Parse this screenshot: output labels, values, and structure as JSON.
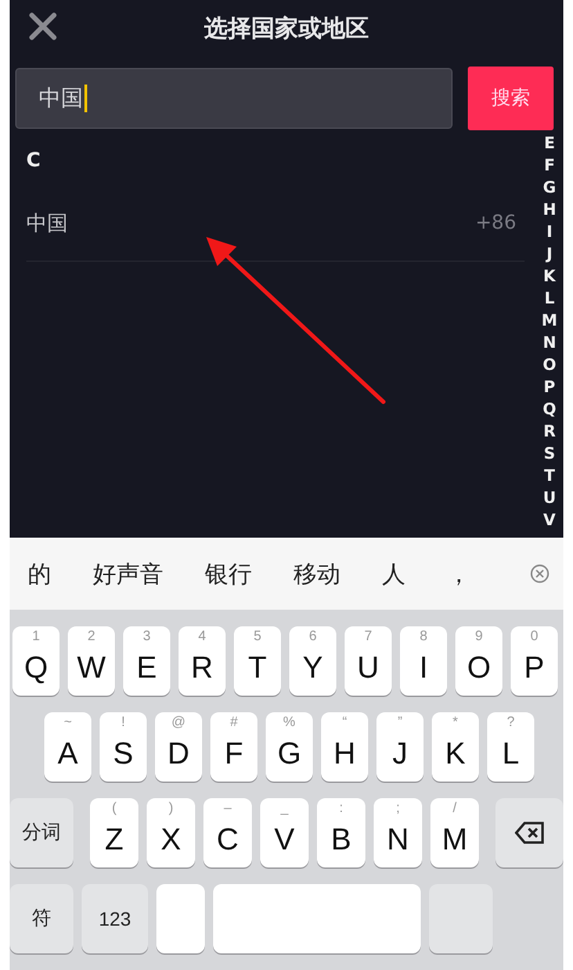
{
  "header": {
    "title": "选择国家或地区"
  },
  "search": {
    "value": "中国",
    "button": "搜索"
  },
  "sections": [
    {
      "letter": "C",
      "countries": [
        {
          "name": "中国",
          "code": "+86"
        }
      ]
    }
  ],
  "index": [
    "E",
    "F",
    "G",
    "H",
    "I",
    "J",
    "K",
    "L",
    "M",
    "N",
    "O",
    "P",
    "Q",
    "R",
    "S",
    "T",
    "U",
    "V"
  ],
  "candidates": [
    "的",
    "好声音",
    "银行",
    "移动",
    "人",
    "，"
  ],
  "keyboard": {
    "rows": [
      [
        {
          "kind": "letter",
          "label": "Q",
          "hint": "1"
        },
        {
          "kind": "letter",
          "label": "W",
          "hint": "2"
        },
        {
          "kind": "letter",
          "label": "E",
          "hint": "3"
        },
        {
          "kind": "letter",
          "label": "R",
          "hint": "4"
        },
        {
          "kind": "letter",
          "label": "T",
          "hint": "5"
        },
        {
          "kind": "letter",
          "label": "Y",
          "hint": "6"
        },
        {
          "kind": "letter",
          "label": "U",
          "hint": "7"
        },
        {
          "kind": "letter",
          "label": "I",
          "hint": "8"
        },
        {
          "kind": "letter",
          "label": "O",
          "hint": "9"
        },
        {
          "kind": "letter",
          "label": "P",
          "hint": "0"
        }
      ],
      [
        {
          "kind": "letter",
          "label": "A",
          "hint": "~"
        },
        {
          "kind": "letter",
          "label": "S",
          "hint": "!"
        },
        {
          "kind": "letter",
          "label": "D",
          "hint": "@"
        },
        {
          "kind": "letter",
          "label": "F",
          "hint": "#"
        },
        {
          "kind": "letter",
          "label": "G",
          "hint": "%"
        },
        {
          "kind": "letter",
          "label": "H",
          "hint": "“"
        },
        {
          "kind": "letter",
          "label": "J",
          "hint": "”"
        },
        {
          "kind": "letter",
          "label": "K",
          "hint": "*"
        },
        {
          "kind": "letter",
          "label": "L",
          "hint": "?"
        }
      ],
      [
        {
          "kind": "function",
          "label": "分词"
        },
        {
          "kind": "letter",
          "label": "Z",
          "hint": "("
        },
        {
          "kind": "letter",
          "label": "X",
          "hint": ")"
        },
        {
          "kind": "letter",
          "label": "C",
          "hint": "–"
        },
        {
          "kind": "letter",
          "label": "V",
          "hint": "_"
        },
        {
          "kind": "letter",
          "label": "B",
          "hint": ":"
        },
        {
          "kind": "letter",
          "label": "N",
          "hint": ";"
        },
        {
          "kind": "letter",
          "label": "M",
          "hint": "/"
        },
        {
          "kind": "backspace"
        }
      ],
      [
        {
          "kind": "function",
          "label": "符"
        },
        {
          "kind": "function",
          "label": "123"
        },
        {
          "kind": "blank"
        },
        {
          "kind": "space"
        },
        {
          "kind": "function_blank"
        }
      ]
    ]
  }
}
